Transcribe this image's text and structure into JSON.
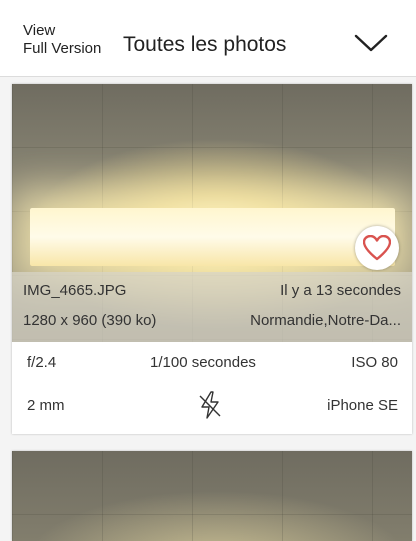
{
  "header": {
    "view_line1": "View",
    "view_line2": "Full Version",
    "title": "Toutes les photos"
  },
  "photo": {
    "filename": "IMG_4665.JPG",
    "time_ago": "Il y a 13 secondes",
    "dimensions": "1280 x 960 (390 ko)",
    "location": "Normandie,Notre-Da...",
    "favorite_icon": "heart-icon"
  },
  "exif": {
    "aperture": "f/2.4",
    "shutter": "1/100 secondes",
    "iso": "ISO 80",
    "focal": "2 mm",
    "flash_icon": "flash-off-icon",
    "device": "iPhone SE"
  },
  "colors": {
    "heart": "#d9534f",
    "background": "#f4f4f4"
  }
}
